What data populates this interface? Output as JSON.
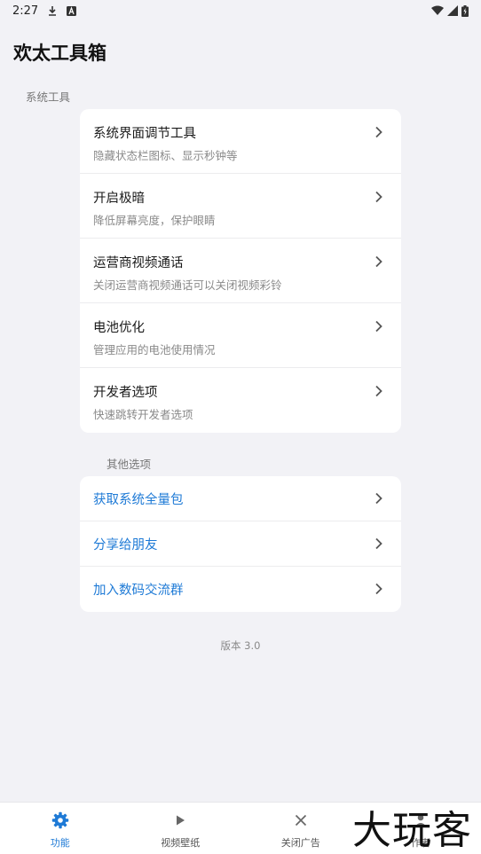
{
  "status_bar": {
    "time": "2:27"
  },
  "app_title": "欢太工具箱",
  "sections": [
    {
      "label": "系统工具",
      "items": [
        {
          "title": "系统界面调节工具",
          "subtitle": "隐藏状态栏图标、显示秒钟等"
        },
        {
          "title": "开启极暗",
          "subtitle": "降低屏幕亮度，保护眼睛"
        },
        {
          "title": "运营商视频通话",
          "subtitle": "关闭运营商视频通话可以关闭视频彩铃"
        },
        {
          "title": "电池优化",
          "subtitle": "管理应用的电池使用情况"
        },
        {
          "title": "开发者选项",
          "subtitle": "快速跳转开发者选项"
        }
      ]
    },
    {
      "label": "其他选项",
      "items": [
        {
          "title": "获取系统全量包"
        },
        {
          "title": "分享给朋友"
        },
        {
          "title": "加入数码交流群"
        }
      ]
    }
  ],
  "version": "版本 3.0",
  "bottom_nav": [
    {
      "label": "功能",
      "icon": "gear-icon",
      "active": true
    },
    {
      "label": "视频壁纸",
      "icon": "play-icon",
      "active": false
    },
    {
      "label": "关闭广告",
      "icon": "close-icon",
      "active": false
    },
    {
      "label": "作者",
      "icon": "person-icon",
      "active": false
    }
  ],
  "watermark": "大玩客",
  "colors": {
    "accent": "#1e7ad6",
    "background": "#f2f2f6",
    "card": "#ffffff"
  }
}
